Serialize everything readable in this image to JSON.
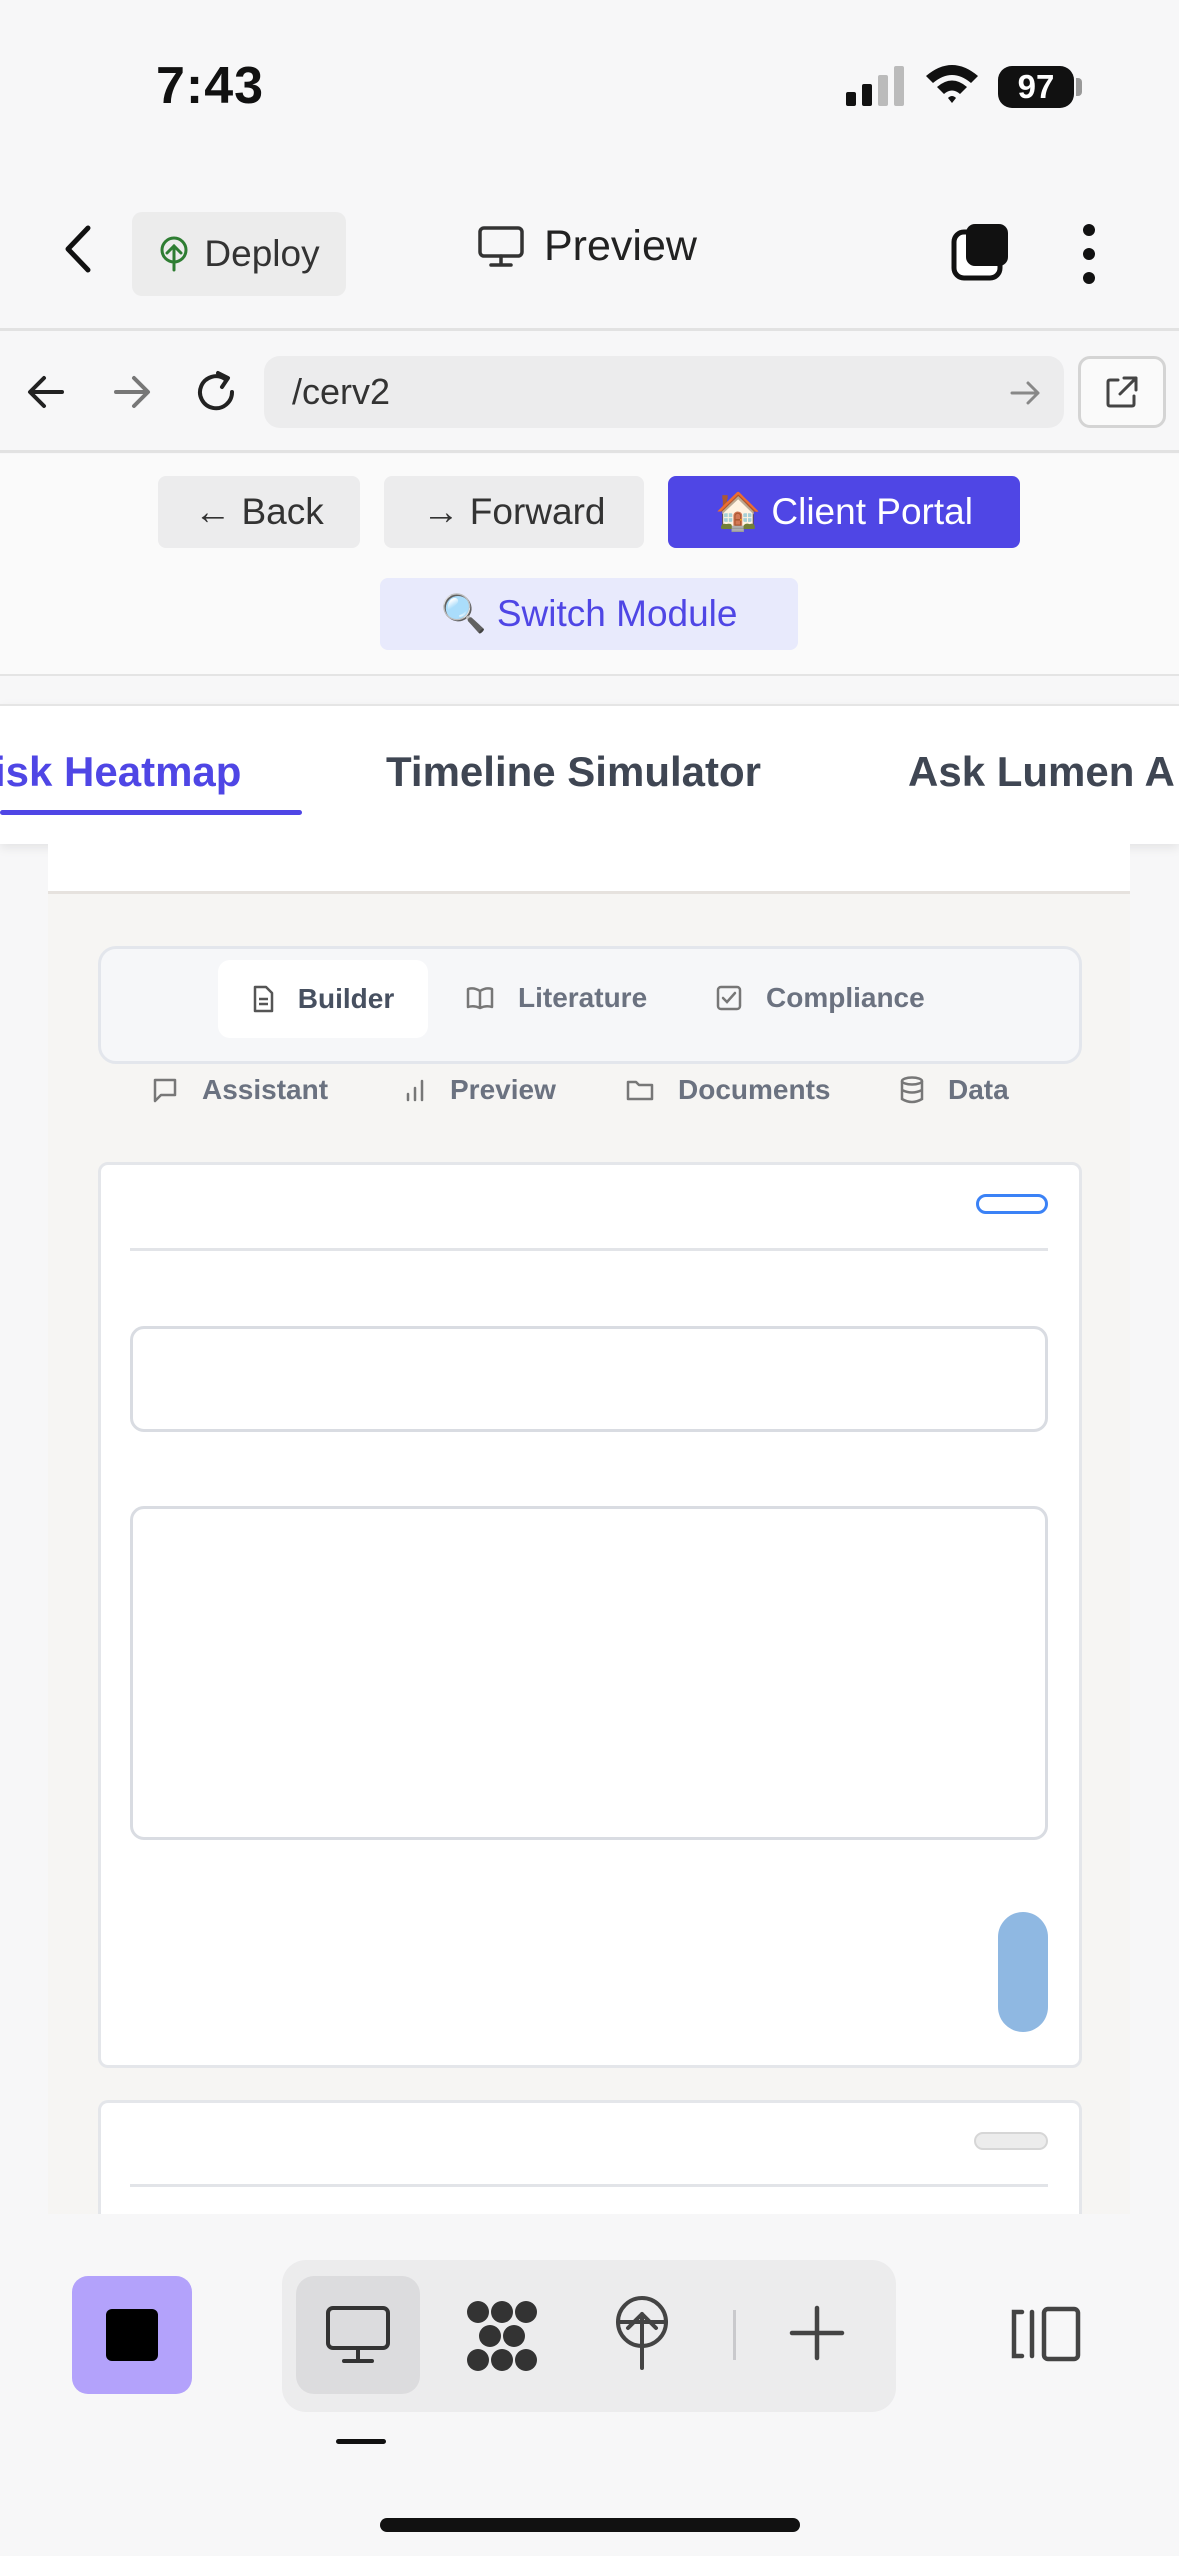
{
  "status_bar": {
    "time": "7:43",
    "battery": "97"
  },
  "header": {
    "deploy_label": "Deploy",
    "title": "Preview"
  },
  "browser": {
    "url": "/cerv2"
  },
  "page_nav": {
    "back_label": "← Back",
    "forward_label": "→ Forward",
    "portal_label": "🏠 Client Portal",
    "switch_label": "🔍 Switch Module"
  },
  "module_tabs": [
    {
      "label": "isk Heatmap",
      "active": true
    },
    {
      "label": "Timeline Simulator",
      "active": false
    },
    {
      "label": "Ask Lumen A",
      "active": false
    }
  ],
  "sub_tabs": [
    {
      "label": "Builder",
      "icon": "document-icon",
      "active": true
    },
    {
      "label": "Literature",
      "icon": "book-icon"
    },
    {
      "label": "Compliance",
      "icon": "checkbox-icon"
    },
    {
      "label": "Assistant",
      "icon": "chat-icon"
    },
    {
      "label": "Preview",
      "icon": "bar-chart-icon"
    },
    {
      "label": "Documents",
      "icon": "folder-icon"
    },
    {
      "label": "Data",
      "icon": "database-icon"
    }
  ],
  "colors": {
    "accent": "#4f46e5",
    "stop_button": "#b3a2fb",
    "fab": "#8fb8e2"
  }
}
